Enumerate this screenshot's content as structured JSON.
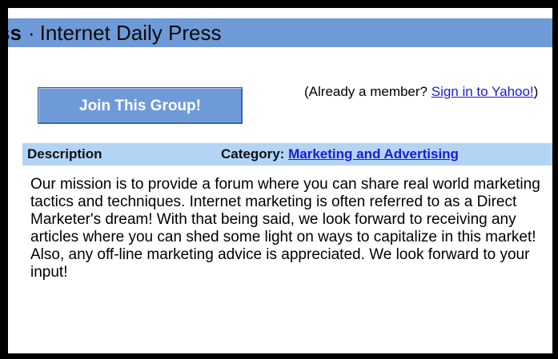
{
  "header": {
    "title_fragment": "ss",
    "separator": "·",
    "group_name": "Internet Daily Press"
  },
  "join": {
    "button_label": "Join This Group!"
  },
  "member_prompt": {
    "prefix": "(Already a member? ",
    "link_text": "Sign in to Yahoo!",
    "suffix": ")"
  },
  "description_bar": {
    "label": "Description",
    "category_label": "Category:",
    "category_value": "Marketing and Advertising"
  },
  "description_text": "Our mission is to provide a forum where you can share real world marketing tactics and techniques. Internet marketing is often referred to as a Direct Marketer's dream! With that being said, we look forward to receiving any articles where you can shed some light on ways to capitalize in this market! Also, any off-line marketing advice is appreciated. We look forward to your input!",
  "colors": {
    "header_bg": "#6f9ad8",
    "description_bar_bg": "#b3d4f5",
    "link": "#1a1ad6",
    "outer_border": "#000000"
  }
}
